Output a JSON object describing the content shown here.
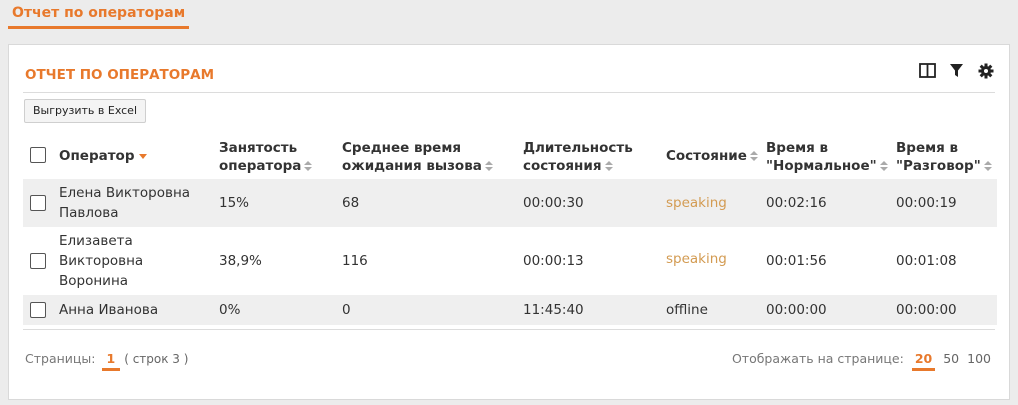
{
  "page_tab": "Отчет по операторам",
  "panel": {
    "title": "ОТЧЕТ ПО ОПЕРАТОРАМ",
    "tools": [
      "columns-icon",
      "filter-icon",
      "gear-icon"
    ],
    "excel_button": "Выгрузить в Excel"
  },
  "columns": [
    {
      "line1": "Оператор",
      "line2": "",
      "sort": "desc"
    },
    {
      "line1": "Занятость",
      "line2": "оператора",
      "sort": "both"
    },
    {
      "line1": "Среднее время",
      "line2": "ожидания вызова",
      "sort": "both"
    },
    {
      "line1": "Длительность",
      "line2": "состояния",
      "sort": "both"
    },
    {
      "line1": "Состояние",
      "line2": "",
      "sort": "both"
    },
    {
      "line1": "Время в",
      "line2": "\"Нормальное\"",
      "sort": "both"
    },
    {
      "line1": "Время в",
      "line2": "\"Разговор\"",
      "sort": "both"
    }
  ],
  "rows": [
    {
      "name": [
        "Елена Викторовна",
        "Павлова"
      ],
      "busy": "15%",
      "avg_wait": "68",
      "duration": "00:00:30",
      "state": "speaking",
      "time_normal": "00:02:16",
      "time_talk": "00:00:19"
    },
    {
      "name": [
        "Елизавета",
        "Викторовна",
        "Воронина"
      ],
      "busy": "38,9%",
      "avg_wait": "116",
      "duration": "00:00:13",
      "state": "speaking",
      "time_normal": "00:01:56",
      "time_talk": "00:01:08"
    },
    {
      "name": [
        "Анна Иванова"
      ],
      "busy": "0%",
      "avg_wait": "0",
      "duration": "11:45:40",
      "state": "offline",
      "time_normal": "00:00:00",
      "time_talk": "00:00:00"
    }
  ],
  "footer": {
    "pages_label": "Страницы:",
    "current_page": "1",
    "rows_info": "( строк 3 )",
    "per_page_label": "Отображать на странице:",
    "page_sizes": [
      "20",
      "50",
      "100"
    ],
    "active_page_size": "20"
  },
  "colors": {
    "accent": "#e8792c",
    "speaking": "#d39b52",
    "alt_row": "#efefef"
  }
}
